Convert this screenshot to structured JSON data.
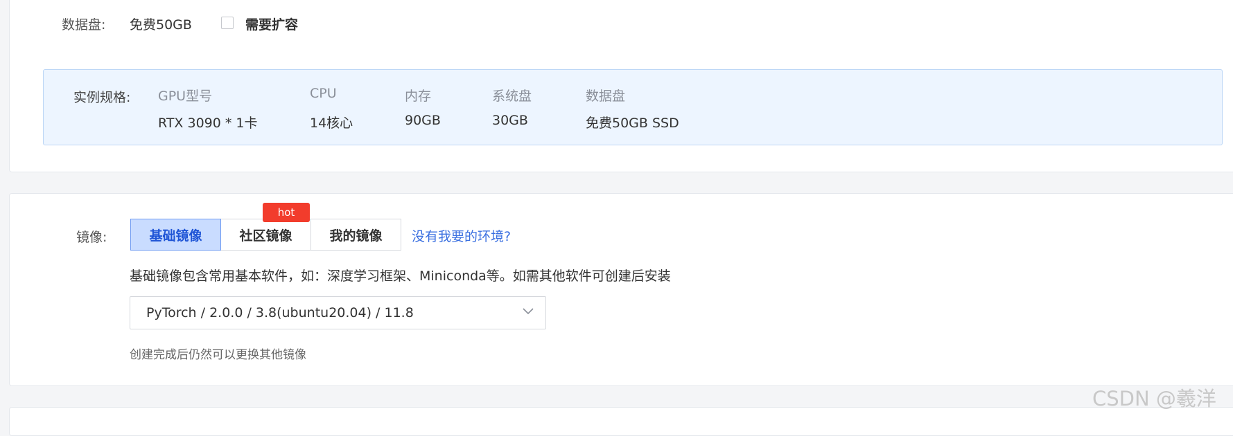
{
  "disk": {
    "label": "数据盘:",
    "value": "免费50GB",
    "expand_label": "需要扩容",
    "expand_checked": false
  },
  "spec": {
    "label": "实例规格:",
    "columns": [
      {
        "header": "GPU型号",
        "value": "RTX 3090 * 1卡"
      },
      {
        "header": "CPU",
        "value": "14核心"
      },
      {
        "header": "内存",
        "value": "90GB"
      },
      {
        "header": "系统盘",
        "value": "30GB"
      },
      {
        "header": "数据盘",
        "value": "免费50GB SSD"
      }
    ]
  },
  "image": {
    "label": "镜像:",
    "tabs": [
      {
        "label": "基础镜像",
        "active": true
      },
      {
        "label": "社区镜像",
        "active": false
      },
      {
        "label": "我的镜像",
        "active": false
      }
    ],
    "hot_badge": "hot",
    "help_link": "没有我要的环境?",
    "description": "基础镜像包含常用基本软件，如：深度学习框架、Miniconda等。如需其他软件可创建后安装",
    "selected_image": "PyTorch / 2.0.0 / 3.8(ubuntu20.04) / 11.8",
    "hint": "创建完成后仍然可以更换其他镜像"
  },
  "watermark": "CSDN @羲洋",
  "colors": {
    "accent": "#3a6fe0",
    "active_tab_bg": "#c9dcff",
    "spec_bg": "#edf5ff",
    "hot": "#f23c2c"
  }
}
